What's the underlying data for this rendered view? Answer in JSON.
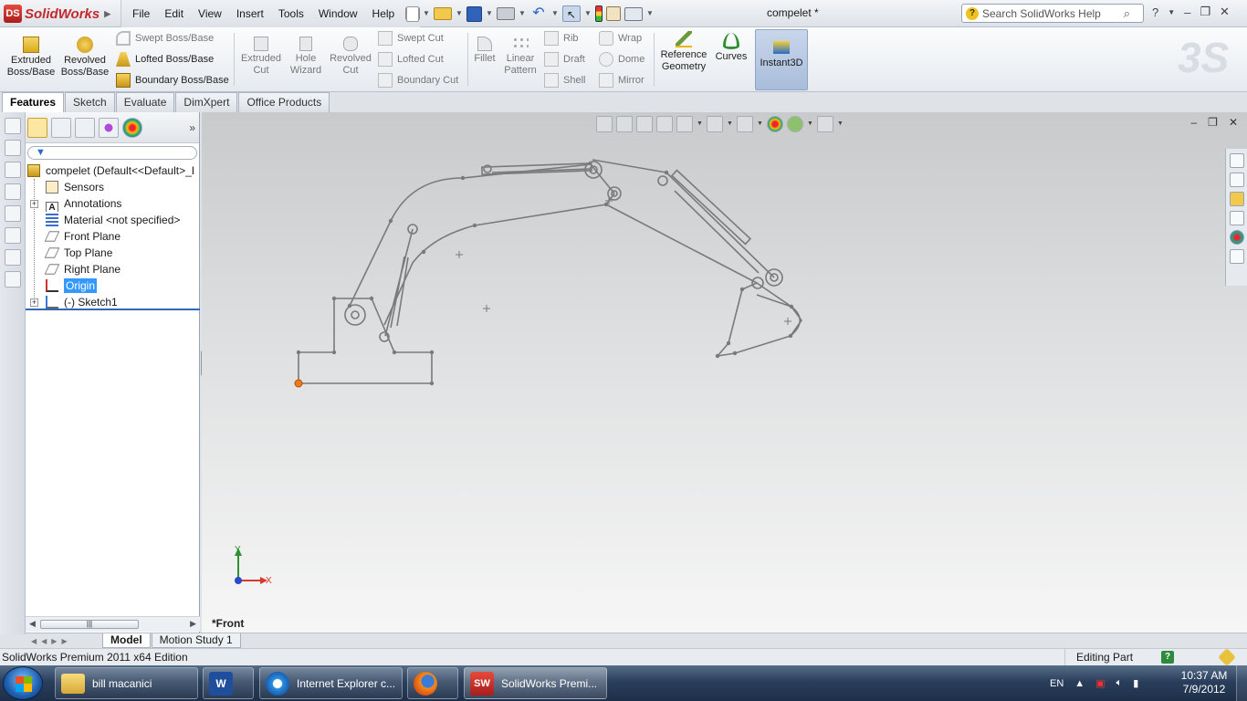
{
  "app": {
    "name": "SolidWorks",
    "document_title": "compelet *"
  },
  "menu": [
    "File",
    "Edit",
    "View",
    "Insert",
    "Tools",
    "Window",
    "Help"
  ],
  "search": {
    "placeholder": "Search SolidWorks Help"
  },
  "ribbon": {
    "extruded_boss": "Extruded Boss/Base",
    "revolved_boss": "Revolved Boss/Base",
    "swept_boss": "Swept Boss/Base",
    "lofted_boss": "Lofted Boss/Base",
    "boundary_boss": "Boundary Boss/Base",
    "extruded_cut": "Extruded Cut",
    "hole_wizard": "Hole Wizard",
    "revolved_cut": "Revolved Cut",
    "swept_cut": "Swept Cut",
    "lofted_cut": "Lofted Cut",
    "boundary_cut": "Boundary Cut",
    "fillet": "Fillet",
    "linear_pattern": "Linear Pattern",
    "rib": "Rib",
    "draft": "Draft",
    "shell": "Shell",
    "wrap": "Wrap",
    "dome": "Dome",
    "mirror": "Mirror",
    "reference_geometry": "Reference Geometry",
    "curves": "Curves",
    "instant3d": "Instant3D"
  },
  "command_tabs": [
    "Features",
    "Sketch",
    "Evaluate",
    "DimXpert",
    "Office Products"
  ],
  "feature_tree": {
    "root": "compelet  (Default<<Default>_I",
    "items": [
      "Sensors",
      "Annotations",
      "Material <not specified>",
      "Front Plane",
      "Top Plane",
      "Right Plane",
      "Origin",
      "(-) Sketch1"
    ]
  },
  "viewport": {
    "view_name": "*Front",
    "axis_x": "X",
    "axis_y": "Y"
  },
  "model_tabs": [
    "Model",
    "Motion Study 1"
  ],
  "status": {
    "edition": "SolidWorks Premium 2011 x64 Edition",
    "mode": "Editing Part",
    "help": "?"
  },
  "taskbar": {
    "items": [
      "bill macanici",
      "Internet Explorer c...",
      "SolidWorks Premi..."
    ],
    "lang": "EN",
    "time": "10:37 AM",
    "date": "7/9/2012"
  }
}
